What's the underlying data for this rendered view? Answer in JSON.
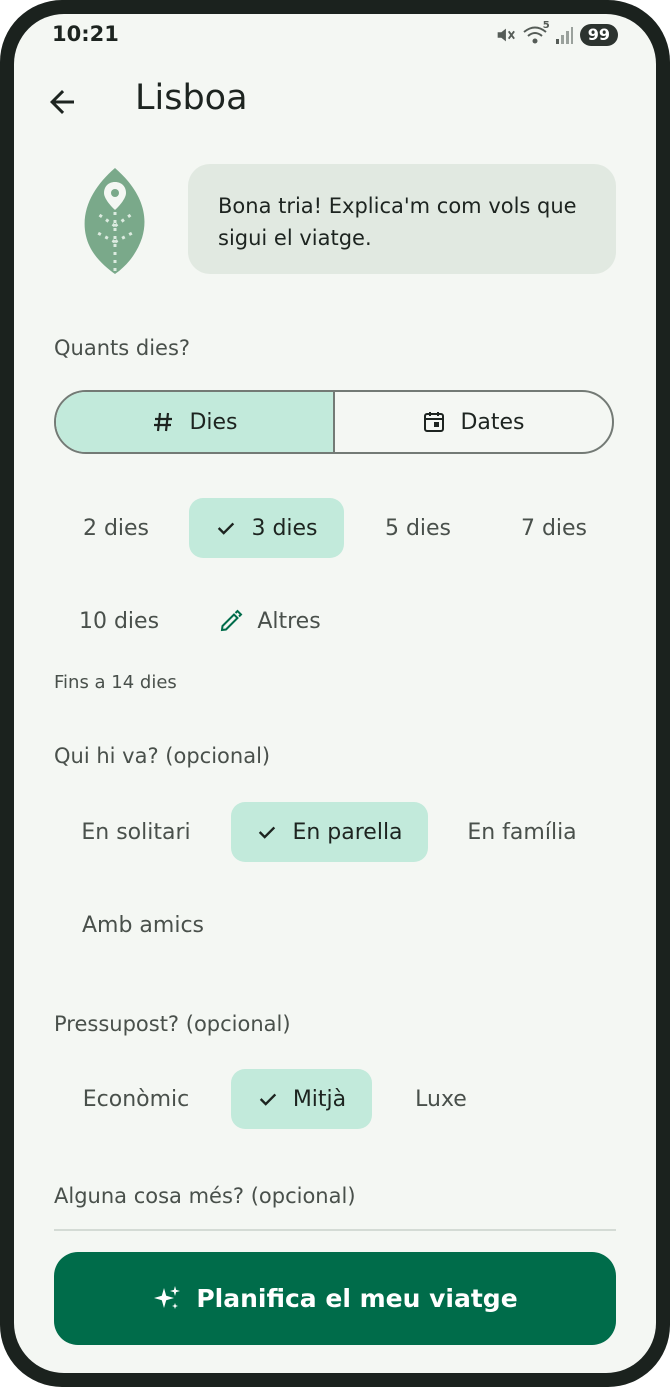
{
  "status": {
    "time": "10:21",
    "battery": "99",
    "signal_badge": "5"
  },
  "header": {
    "title": "Lisboa"
  },
  "assistant": {
    "message": "Bona tria! Explica'm com vols que sigui el viatge."
  },
  "duration": {
    "label": "Quants dies?",
    "modes": [
      {
        "label": "Dies",
        "selected": true
      },
      {
        "label": "Dates",
        "selected": false
      }
    ],
    "options": [
      "2 dies",
      "3 dies",
      "5 dies",
      "7 dies",
      "10 dies",
      "Altres"
    ],
    "selected": "3 dies",
    "hint": "Fins a 14 dies"
  },
  "companions": {
    "label": "Qui hi va?  (opcional)",
    "options": [
      "En solitari",
      "En parella",
      "En família",
      "Amb amics"
    ],
    "selected": "En parella"
  },
  "budget": {
    "label": "Pressupost?  (opcional)",
    "options": [
      "Econòmic",
      "Mitjà",
      "Luxe"
    ],
    "selected": "Mitjà"
  },
  "extra": {
    "label": "Alguna cosa més?  (opcional)"
  },
  "cta": {
    "label": "Planifica el meu viatge"
  },
  "colors": {
    "accent": "#006c4a",
    "chip_selected": "#c2eadb",
    "bubble": "#e1e9e1",
    "background": "#f4f7f3"
  }
}
